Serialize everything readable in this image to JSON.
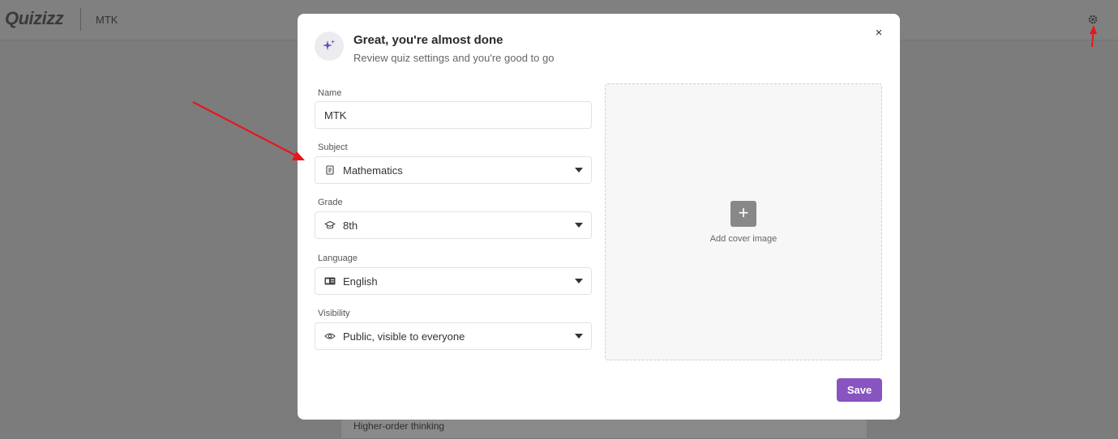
{
  "app": {
    "logo_text": "Quizizz",
    "doc_title": "MTK",
    "background_text": "Higher-order thinking"
  },
  "modal": {
    "title": "Great, you're almost done",
    "subtitle": "Review quiz settings and you're good to go",
    "close_glyph": "×",
    "fields": {
      "name": {
        "label": "Name",
        "value": "MTK"
      },
      "subject": {
        "label": "Subject",
        "value": "Mathematics",
        "icon": "book-icon"
      },
      "grade": {
        "label": "Grade",
        "value": "8th",
        "icon": "graduation-cap-icon"
      },
      "language": {
        "label": "Language",
        "value": "English",
        "icon": "language-card-icon"
      },
      "visibility": {
        "label": "Visibility",
        "value": "Public, visible to everyone",
        "icon": "eye-icon"
      }
    },
    "cover": {
      "plus_glyph": "+",
      "label": "Add cover image"
    },
    "save_label": "Save"
  },
  "colors": {
    "accent": "#8854c0",
    "overlay": "#7c7c7c",
    "annotation": "#e8151b"
  }
}
